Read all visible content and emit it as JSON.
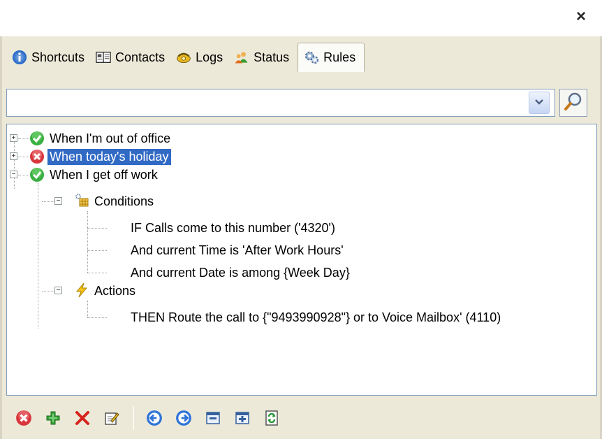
{
  "window": {
    "close_label": "×"
  },
  "tabs": [
    {
      "label": "Shortcuts",
      "icon": "info-icon"
    },
    {
      "label": "Contacts",
      "icon": "address-book-icon"
    },
    {
      "label": "Logs",
      "icon": "phone-icon"
    },
    {
      "label": "Status",
      "icon": "users-icon"
    },
    {
      "label": "Rules",
      "icon": "gears-icon",
      "active": true
    }
  ],
  "search": {
    "value": "",
    "placeholder": ""
  },
  "tree": {
    "rules": [
      {
        "label": "When I'm out of office",
        "status": "enabled",
        "expanded": false
      },
      {
        "label": "When today's holiday",
        "status": "disabled",
        "expanded": false,
        "selected": true
      },
      {
        "label": "When I get off work",
        "status": "enabled",
        "expanded": true
      }
    ],
    "conditions_label": "Conditions",
    "conditions": [
      "IF Calls come to this number ('4320')",
      "And current Time is 'After Work Hours'",
      "And current Date is among {Week Day}"
    ],
    "actions_label": "Actions",
    "actions": [
      "THEN Route the call to {\"9493990928\"} or to Voice Mailbox'  (4110)"
    ]
  },
  "toolbar": {
    "buttons": [
      "disable-rule-icon",
      "add-rule-icon",
      "delete-rule-icon",
      "edit-rule-icon",
      "move-up-icon",
      "move-down-icon",
      "collapse-icon",
      "expand-icon",
      "refresh-icon"
    ]
  },
  "colors": {
    "panel_bg": "#ece9d8",
    "selection_bg": "#316ac5",
    "enabled_green": "#3cb043",
    "disabled_red": "#d9363e"
  }
}
